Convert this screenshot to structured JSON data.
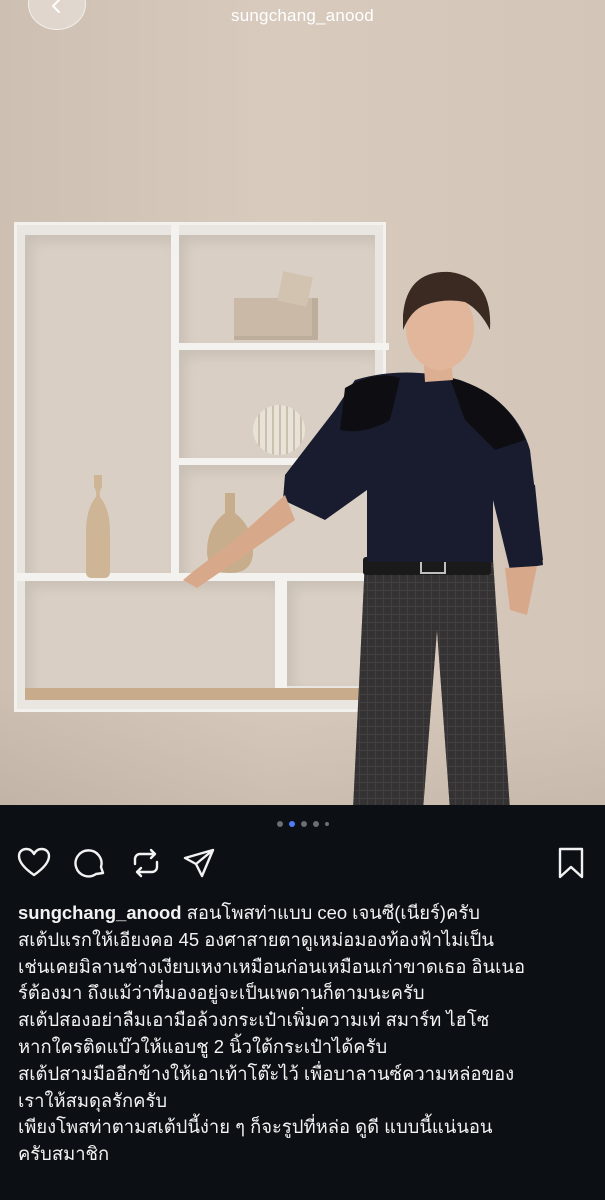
{
  "header": {
    "username": "sungchang_anood",
    "back_icon": "chevron-left-icon"
  },
  "carousel": {
    "dots": 5,
    "active_index": 1
  },
  "actions": {
    "like_icon": "heart-icon",
    "comment_icon": "comment-icon",
    "repost_icon": "repost-icon",
    "share_icon": "send-icon",
    "save_icon": "bookmark-icon"
  },
  "caption": {
    "username": "sungchang_anood",
    "lines": [
      " สอนโพสท่าแบบ ceo เจนซี(เนียร์)ครับ",
      "สเต้ปแรกให้เอียงคอ 45 องศาสายตาดูเหม่อมองท้องฟ้าไม่เป็น",
      "เช่นเคยมิลานช่างเงียบเหงาเหมือนก่อนเหมือนเก่าขาดเธอ อินเนอ",
      "ร์ต้องมา ถึงแม้ว่าที่มองอยู่จะเป็นเพดานก็ตามนะครับ",
      "สเต้ปสองอย่าลืมเอามือล้วงกระเป๋าเพิ่มความเท่ สมาร์ท ไฮโซ",
      "หากใครติดแบ๊วให้แอบชู 2 นิ้วใต้กระเป๋าได้ครับ",
      "สเต้ปสามมืออีกข้างให้เอาเท้าโต๊ะไว้ เพื่อบาลานซ์ความหล่อของ",
      "เราให้สมดุลรักครับ",
      "เพียงโพสท่าตามสเต้ปนี้ง่าย ๆ ก็จะรูปที่หล่อ ดูดี แบบนี้แน่นอน",
      "ครับสมาชิก"
    ]
  },
  "colors": {
    "background": "#0c1014",
    "text": "#f2f2f2",
    "active_dot": "#4e7cf7"
  }
}
